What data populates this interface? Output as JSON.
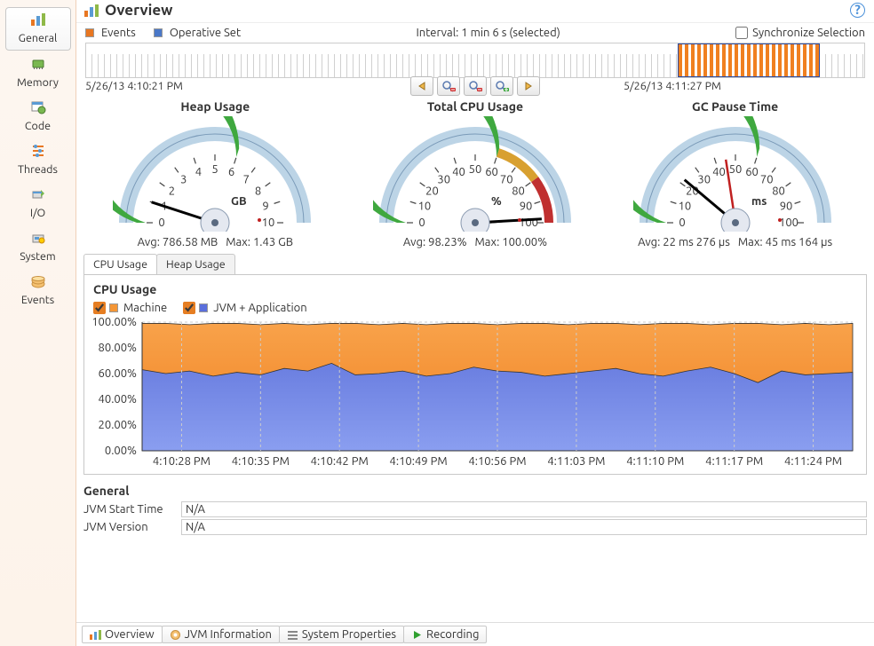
{
  "page_title": "Overview",
  "help": "?",
  "sidebar": {
    "items": [
      {
        "label": "General"
      },
      {
        "label": "Memory"
      },
      {
        "label": "Code"
      },
      {
        "label": "Threads"
      },
      {
        "label": "I/O"
      },
      {
        "label": "System"
      },
      {
        "label": "Events"
      }
    ]
  },
  "topbar": {
    "events_label": "Events",
    "opset_label": "Operative Set",
    "interval": "Interval: 1 min 6 s (selected)",
    "sync_label": "Synchronize Selection"
  },
  "timeline": {
    "start": "5/26/13 4:10:21 PM",
    "end": "5/26/13 4:11:27 PM"
  },
  "gauges": [
    {
      "title": "Heap Usage",
      "unit": "GB",
      "avg": "Avg: 786.58 MB",
      "max": "Max: 1.43 GB",
      "ticks": [
        "0",
        "1",
        "2",
        "3",
        "4",
        "5",
        "6",
        "7",
        "8",
        "9",
        "10"
      ],
      "needle": 0.1,
      "green_to": 0.6
    },
    {
      "title": "Total CPU Usage",
      "unit": "%",
      "avg": "Avg: 98.23%",
      "max": "Max: 100.00%",
      "ticks": [
        "0",
        "10",
        "20",
        "30",
        "40",
        "50",
        "60",
        "70",
        "80",
        "90",
        "100"
      ],
      "needle": 0.982,
      "green_to": 0.6,
      "amber_to": 0.8,
      "red": true
    },
    {
      "title": "GC Pause Time",
      "unit": "ms",
      "avg": "Avg: 22 ms 276 µs",
      "max": "Max: 45 ms 164 µs",
      "ticks": [
        "0",
        "10",
        "20",
        "30",
        "40",
        "50",
        "60",
        "70",
        "80",
        "90",
        "100"
      ],
      "needle": 0.223,
      "green_to": 0.6,
      "second_needle": 0.452
    }
  ],
  "chart_tabs": [
    {
      "label": "CPU Usage"
    },
    {
      "label": "Heap Usage"
    }
  ],
  "chart_heading": "CPU Usage",
  "chart_legend": [
    {
      "label": "Machine",
      "color": "#f49636"
    },
    {
      "label": "JVM + Application",
      "color": "#5a6fdc"
    }
  ],
  "chart_data": {
    "type": "area",
    "ylabel": "",
    "xlabel": "",
    "ylim": [
      0,
      100
    ],
    "yticks": [
      "0.00%",
      "20.00%",
      "40.00%",
      "60.00%",
      "80.00%",
      "100.00%"
    ],
    "xticks": [
      "4:10:28 PM",
      "4:10:35 PM",
      "4:10:42 PM",
      "4:10:49 PM",
      "4:10:56 PM",
      "4:11:03 PM",
      "4:11:10 PM",
      "4:11:17 PM",
      "4:11:24 PM"
    ],
    "series": [
      {
        "name": "Machine",
        "color": "#f49636",
        "values": [
          99,
          99,
          98,
          99,
          99,
          98,
          99,
          98,
          99,
          99,
          98,
          99,
          98,
          99,
          99,
          98,
          99,
          99,
          98,
          99,
          99,
          98,
          99,
          99,
          98,
          99,
          99,
          98,
          99,
          98,
          99
        ]
      },
      {
        "name": "JVM + Application",
        "color": "#5a6fdc",
        "values": [
          63,
          60,
          62,
          58,
          61,
          59,
          64,
          62,
          68,
          59,
          60,
          62,
          58,
          60,
          65,
          62,
          61,
          58,
          60,
          62,
          64,
          60,
          58,
          62,
          65,
          60,
          53,
          62,
          59,
          60,
          61
        ]
      }
    ]
  },
  "general_section": {
    "heading": "General",
    "rows": [
      {
        "label": "JVM Start Time",
        "value": "N/A"
      },
      {
        "label": "JVM Version",
        "value": "N/A"
      }
    ]
  },
  "bottom_tabs": [
    {
      "label": "Overview"
    },
    {
      "label": "JVM Information"
    },
    {
      "label": "System Properties"
    },
    {
      "label": "Recording"
    }
  ]
}
